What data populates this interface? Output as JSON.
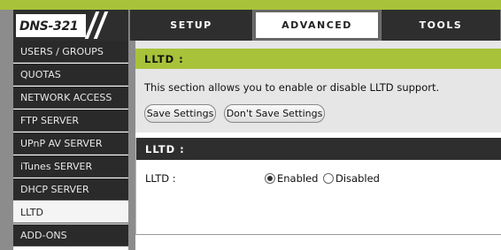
{
  "logo": {
    "text": "DNS-321"
  },
  "nav_tabs": [
    {
      "label": "SETUP",
      "active": false
    },
    {
      "label": "ADVANCED",
      "active": true
    },
    {
      "label": "TOOLS",
      "active": false
    }
  ],
  "sidebar": {
    "items": [
      {
        "label": "USERS / GROUPS",
        "active": false
      },
      {
        "label": "QUOTAS",
        "active": false
      },
      {
        "label": "NETWORK ACCESS",
        "active": false
      },
      {
        "label": "FTP SERVER",
        "active": false
      },
      {
        "label": "UPnP AV SERVER",
        "active": false
      },
      {
        "label": "iTunes SERVER",
        "active": false
      },
      {
        "label": "DHCP SERVER",
        "active": false
      },
      {
        "label": "LLTD",
        "active": true
      },
      {
        "label": "ADD-ONS",
        "active": false
      }
    ]
  },
  "section1": {
    "title": "LLTD :",
    "description": "This section allows you to enable or disable LLTD support.",
    "save_label": "Save Settings",
    "dont_save_label": "Don't Save Settings"
  },
  "section2": {
    "title": "LLTD :",
    "field_label": "LLTD :",
    "options": [
      {
        "label": "Enabled",
        "checked": true
      },
      {
        "label": "Disabled",
        "checked": false
      }
    ]
  },
  "colors": {
    "accent": "#a8c23a",
    "dark": "#2e2e2e",
    "panel_bg": "#e6e6e6"
  }
}
